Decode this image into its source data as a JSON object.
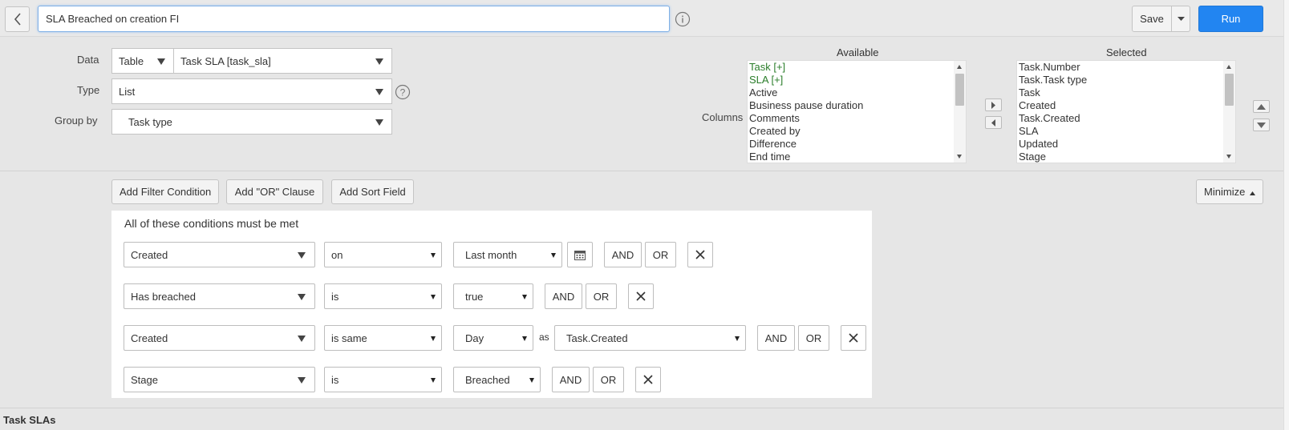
{
  "header": {
    "report_title": "SLA Breached on creation FI",
    "save_label": "Save",
    "run_label": "Run"
  },
  "config": {
    "data_label": "Data",
    "data_source_type": "Table",
    "data_table": "Task SLA [task_sla]",
    "type_label": "Type",
    "type_value": "List",
    "group_by_label": "Group by",
    "group_by_value": "Task type",
    "columns_label": "Columns",
    "available_heading": "Available",
    "selected_heading": "Selected",
    "available_columns": [
      {
        "label": "Task [+]",
        "expandable": true
      },
      {
        "label": "SLA [+]",
        "expandable": true
      },
      {
        "label": "Active",
        "expandable": false
      },
      {
        "label": "Business pause duration",
        "expandable": false
      },
      {
        "label": "Comments",
        "expandable": false
      },
      {
        "label": "Created by",
        "expandable": false
      },
      {
        "label": "Difference",
        "expandable": false
      },
      {
        "label": "End time",
        "expandable": false
      }
    ],
    "selected_columns": [
      "Task.Number",
      "Task.Task type",
      "Task",
      "Created",
      "Task.Created",
      "SLA",
      "Updated",
      "Stage"
    ]
  },
  "filter": {
    "add_filter_label": "Add Filter Condition",
    "add_or_label": "Add \"OR\" Clause",
    "add_sort_label": "Add Sort Field",
    "minimize_label": "Minimize",
    "conditions_title": "All of these conditions must be met",
    "and_label": "AND",
    "or_label": "OR",
    "as_label": "as",
    "conditions": [
      {
        "field": "Created",
        "operator": "on",
        "value": "Last month"
      },
      {
        "field": "Has breached",
        "operator": "is",
        "value": "true"
      },
      {
        "field": "Created",
        "operator": "is same",
        "value": "Day",
        "compare_field": "Task.Created"
      },
      {
        "field": "Stage",
        "operator": "is",
        "value": "Breached"
      }
    ]
  },
  "results": {
    "title": "Task SLAs"
  },
  "colors": {
    "accent": "#2285f1",
    "expandable_column": "#2a7d2a"
  }
}
